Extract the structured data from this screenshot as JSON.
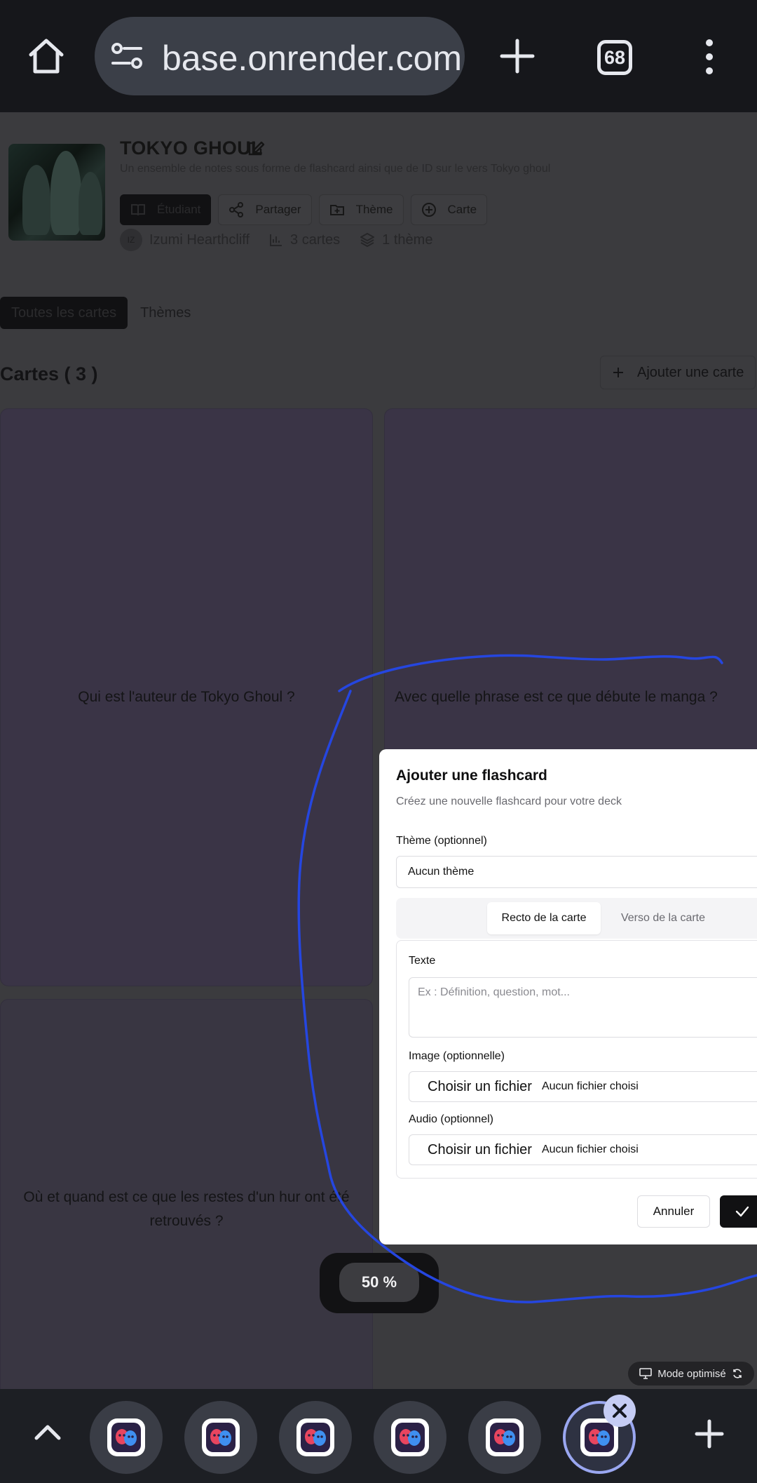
{
  "browser": {
    "url": "base.onrender.com",
    "tab_count": "68"
  },
  "deck": {
    "title": "TOKYO GHOUL",
    "description": "Un ensemble de notes sous forme de flashcard ainsi que de ID sur le vers Tokyo ghoul",
    "buttons": {
      "student": "Étudiant",
      "share": "Partager",
      "theme": "Thème",
      "card": "Carte"
    },
    "author_initials": "IZ",
    "author": "Izumi Hearthcliff",
    "card_count": "3 cartes",
    "theme_count": "1 thème"
  },
  "tabs": {
    "all": "Toutes les cartes",
    "themes": "Thèmes"
  },
  "cards_section": {
    "title": "Cartes ( 3 )",
    "add_label": "Ajouter une carte"
  },
  "cards": [
    {
      "text": "Qui est l'auteur de Tokyo Ghoul ?"
    },
    {
      "text": "Avec quelle phrase est ce que débute le manga ?"
    },
    {
      "text": "Où et quand est ce que les restes d'un hur ont été retrouvés ?"
    }
  ],
  "modal": {
    "title": "Ajouter une flashcard",
    "subtitle": "Créez une nouvelle flashcard pour votre deck",
    "theme_label": "Thème (optionnel)",
    "theme_value": "Aucun thème",
    "tab_front": "Recto de la carte",
    "tab_back": "Verso de la carte",
    "text_label": "Texte",
    "text_placeholder": "Ex : Définition, question, mot...",
    "image_label": "Image (optionnelle)",
    "audio_label": "Audio (optionnel)",
    "choose_file": "Choisir un fichier",
    "no_file": "Aucun fichier choisi",
    "cancel": "Annuler"
  },
  "zoom": "50 %",
  "mode": "Mode optimisé",
  "colors": {
    "modal_bg": "#ffffff",
    "primary_button": "#111113",
    "annotation_stroke": "#2546e0",
    "active_tab_ring": "#9aa7f0"
  }
}
